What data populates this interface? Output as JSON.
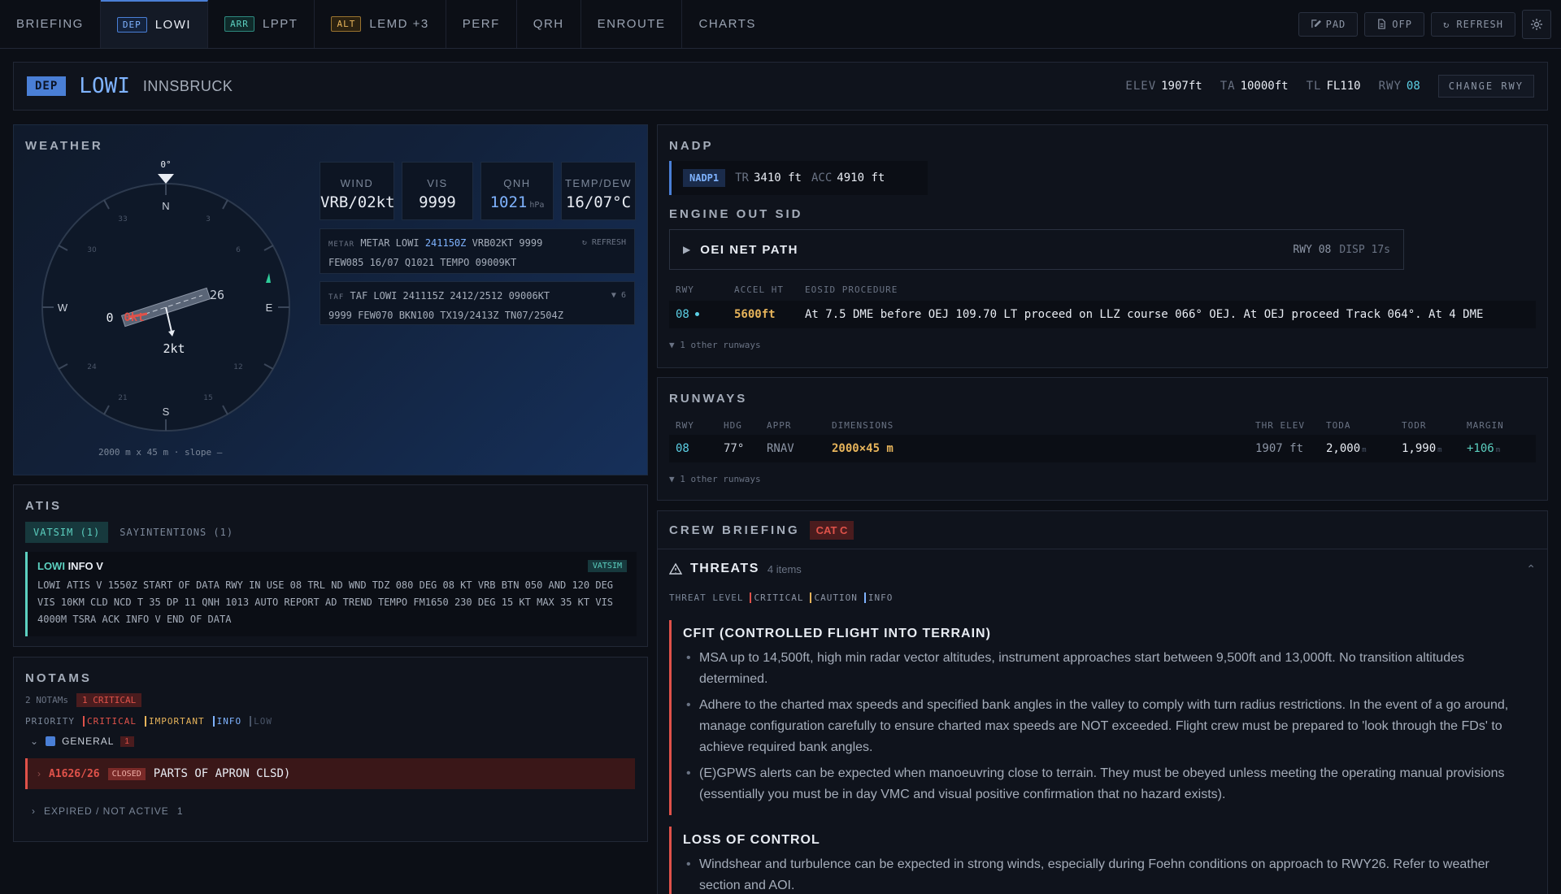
{
  "nav": {
    "tabs": [
      {
        "label": "BRIEFING"
      },
      {
        "badge": "DEP",
        "label": "LOWI"
      },
      {
        "badge": "ARR",
        "label": "LPPT"
      },
      {
        "badge": "ALT",
        "label": "LEMD +3"
      },
      {
        "label": "PERF"
      },
      {
        "label": "QRH"
      },
      {
        "label": "ENROUTE"
      },
      {
        "label": "CHARTS"
      }
    ],
    "pad": "PAD",
    "ofp": "OFP",
    "refresh": "↻ REFRESH"
  },
  "airport": {
    "badge": "DEP",
    "icao": "LOWI",
    "name": "INNSBRUCK",
    "elev_label": "ELEV",
    "elev": "1907ft",
    "ta_label": "TA",
    "ta": "10000ft",
    "tl_label": "TL",
    "tl": "FL110",
    "rwy_label": "RWY",
    "rwy": "08",
    "change_rwy": "CHANGE RWY"
  },
  "weather": {
    "title": "WEATHER",
    "compass": {
      "heading_label": "0°",
      "n": "N",
      "s": "S",
      "e": "E",
      "w": "W",
      "ticks": [
        "3",
        "6",
        "12",
        "15",
        "21",
        "24",
        "30",
        "33"
      ],
      "rwy_left": "0",
      "rwy_right": "26",
      "crosswind": "0kt",
      "headwind": "2kt",
      "footer": "2000 m x 45 m · slope —"
    },
    "wind_label": "WIND",
    "wind": "VRB/02kt",
    "vis_label": "VIS",
    "vis": "9999",
    "qnh_label": "QNH",
    "qnh": "1021",
    "qnh_unit": "hPa",
    "temp_label": "TEMP/DEW",
    "temp": "16/07°C",
    "metar_tag": "METAR",
    "metar_a": "METAR LOWI",
    "metar_time": "241150Z",
    "metar_b": "VRB02KT 9999",
    "metar_line2": "FEW085 16/07 Q1021 TEMPO 09009KT",
    "metar_refresh": "↻ REFRESH",
    "taf_tag": "TAF",
    "taf_line1": "TAF LOWI 241115Z 2412/2512 09006KT",
    "taf_line2": "9999 FEW070 BKN100 TX19/2413Z TN07/2504Z",
    "taf_count": "6"
  },
  "atis": {
    "title": "ATIS",
    "tab_vatsim": "VATSIM (1)",
    "tab_sayint": "SAYINTENTIONS (1)",
    "station": "LOWI",
    "info": "INFO V",
    "source": "VATSIM",
    "text": "LOWI ATIS V 1550Z START OF DATA RWY IN USE 08 TRL ND WND TDZ 080 DEG 08 KT VRB BTN 050 AND 120 DEG VIS 10KM CLD NCD T 35 DP 11 QNH 1013 AUTO REPORT AD TREND TEMPO FM1650 230 DEG 15 KT MAX 35 KT VIS 4000M TSRA ACK INFO V END OF DATA"
  },
  "notams": {
    "title": "NOTAMS",
    "count": "2 NOTAMs",
    "critical_badge": "1 CRITICAL",
    "priority_label": "PRIORITY",
    "levels": [
      "CRITICAL",
      "IMPORTANT",
      "INFO",
      "LOW"
    ],
    "group_label": "GENERAL",
    "group_count": "1",
    "item_id": "A1626/26",
    "item_status": "CLOSED",
    "item_text": "PARTS OF APRON CLSD)",
    "expired_label": "EXPIRED / NOT ACTIVE",
    "expired_count": "1"
  },
  "nadp": {
    "title": "NADP",
    "badge": "NADP1",
    "tr_label": "TR",
    "tr": "3410 ft",
    "acc_label": "ACC",
    "acc": "4910 ft",
    "eosid_title": "ENGINE OUT SID",
    "oei_label": "OEI NET PATH",
    "oei_rwy": "RWY 08",
    "oei_disp": "DISP 17s",
    "col_rwy": "RWY",
    "col_accel": "ACCEL HT",
    "col_proc": "EOSID PROCEDURE",
    "row_rwy": "08",
    "row_accel": "5600ft",
    "row_proc": "At 7.5 DME before OEJ 109.70 LT proceed on LLZ course 066° OEJ. At OEJ proceed Track 064°. At 4 DME",
    "other": "1 other runways"
  },
  "runways": {
    "title": "RUNWAYS",
    "headers": [
      "RWY",
      "HDG",
      "APPR",
      "DIMENSIONS",
      "THR ELEV",
      "TODA",
      "TODR",
      "MARGIN"
    ],
    "row": {
      "rwy": "08",
      "hdg": "77°",
      "appr": "RNAV",
      "dim": "2000×45 m",
      "thr": "1907 ft",
      "toda": "2,000",
      "todr": "1,990",
      "margin": "+106",
      "unit": "m"
    },
    "other": "1 other runways"
  },
  "crew": {
    "title": "CREW BRIEFING",
    "cat": "CAT C",
    "threats_label": "THREATS",
    "threats_count": "4 items",
    "level_label": "THREAT LEVEL",
    "levels": [
      "CRITICAL",
      "CAUTION",
      "INFO"
    ],
    "t1_title": "CFIT (CONTROLLED FLIGHT INTO TERRAIN)",
    "t1_b1": "MSA up to 14,500ft, high min radar vector altitudes, instrument approaches start between 9,500ft and 13,000ft. No transition altitudes determined.",
    "t1_b2": "Adhere to the charted max speeds and specified bank angles in the valley to comply with turn radius restrictions. In the event of a go around, manage configuration carefully to ensure charted max speeds are NOT exceeded. Flight crew must be prepared to 'look through the FDs' to achieve required bank angles.",
    "t1_b3": "(E)GPWS alerts can be expected when manoeuvring close to terrain. They must be obeyed unless meeting the operating manual provisions (essentially you must be in day VMC and visual positive confirmation that no hazard exists).",
    "t2_title": "LOSS OF CONTROL",
    "t2_b1": "Windshear and turbulence can be expected in strong winds, especially during Foehn conditions on approach to RWY26. Refer to weather section and AOI."
  },
  "colors": {
    "accent_blue": "#4a7fd6",
    "cyan": "#5cd0c0",
    "critical": "#e0524a",
    "caution": "#e7b45b",
    "info": "#7fb3ff"
  }
}
